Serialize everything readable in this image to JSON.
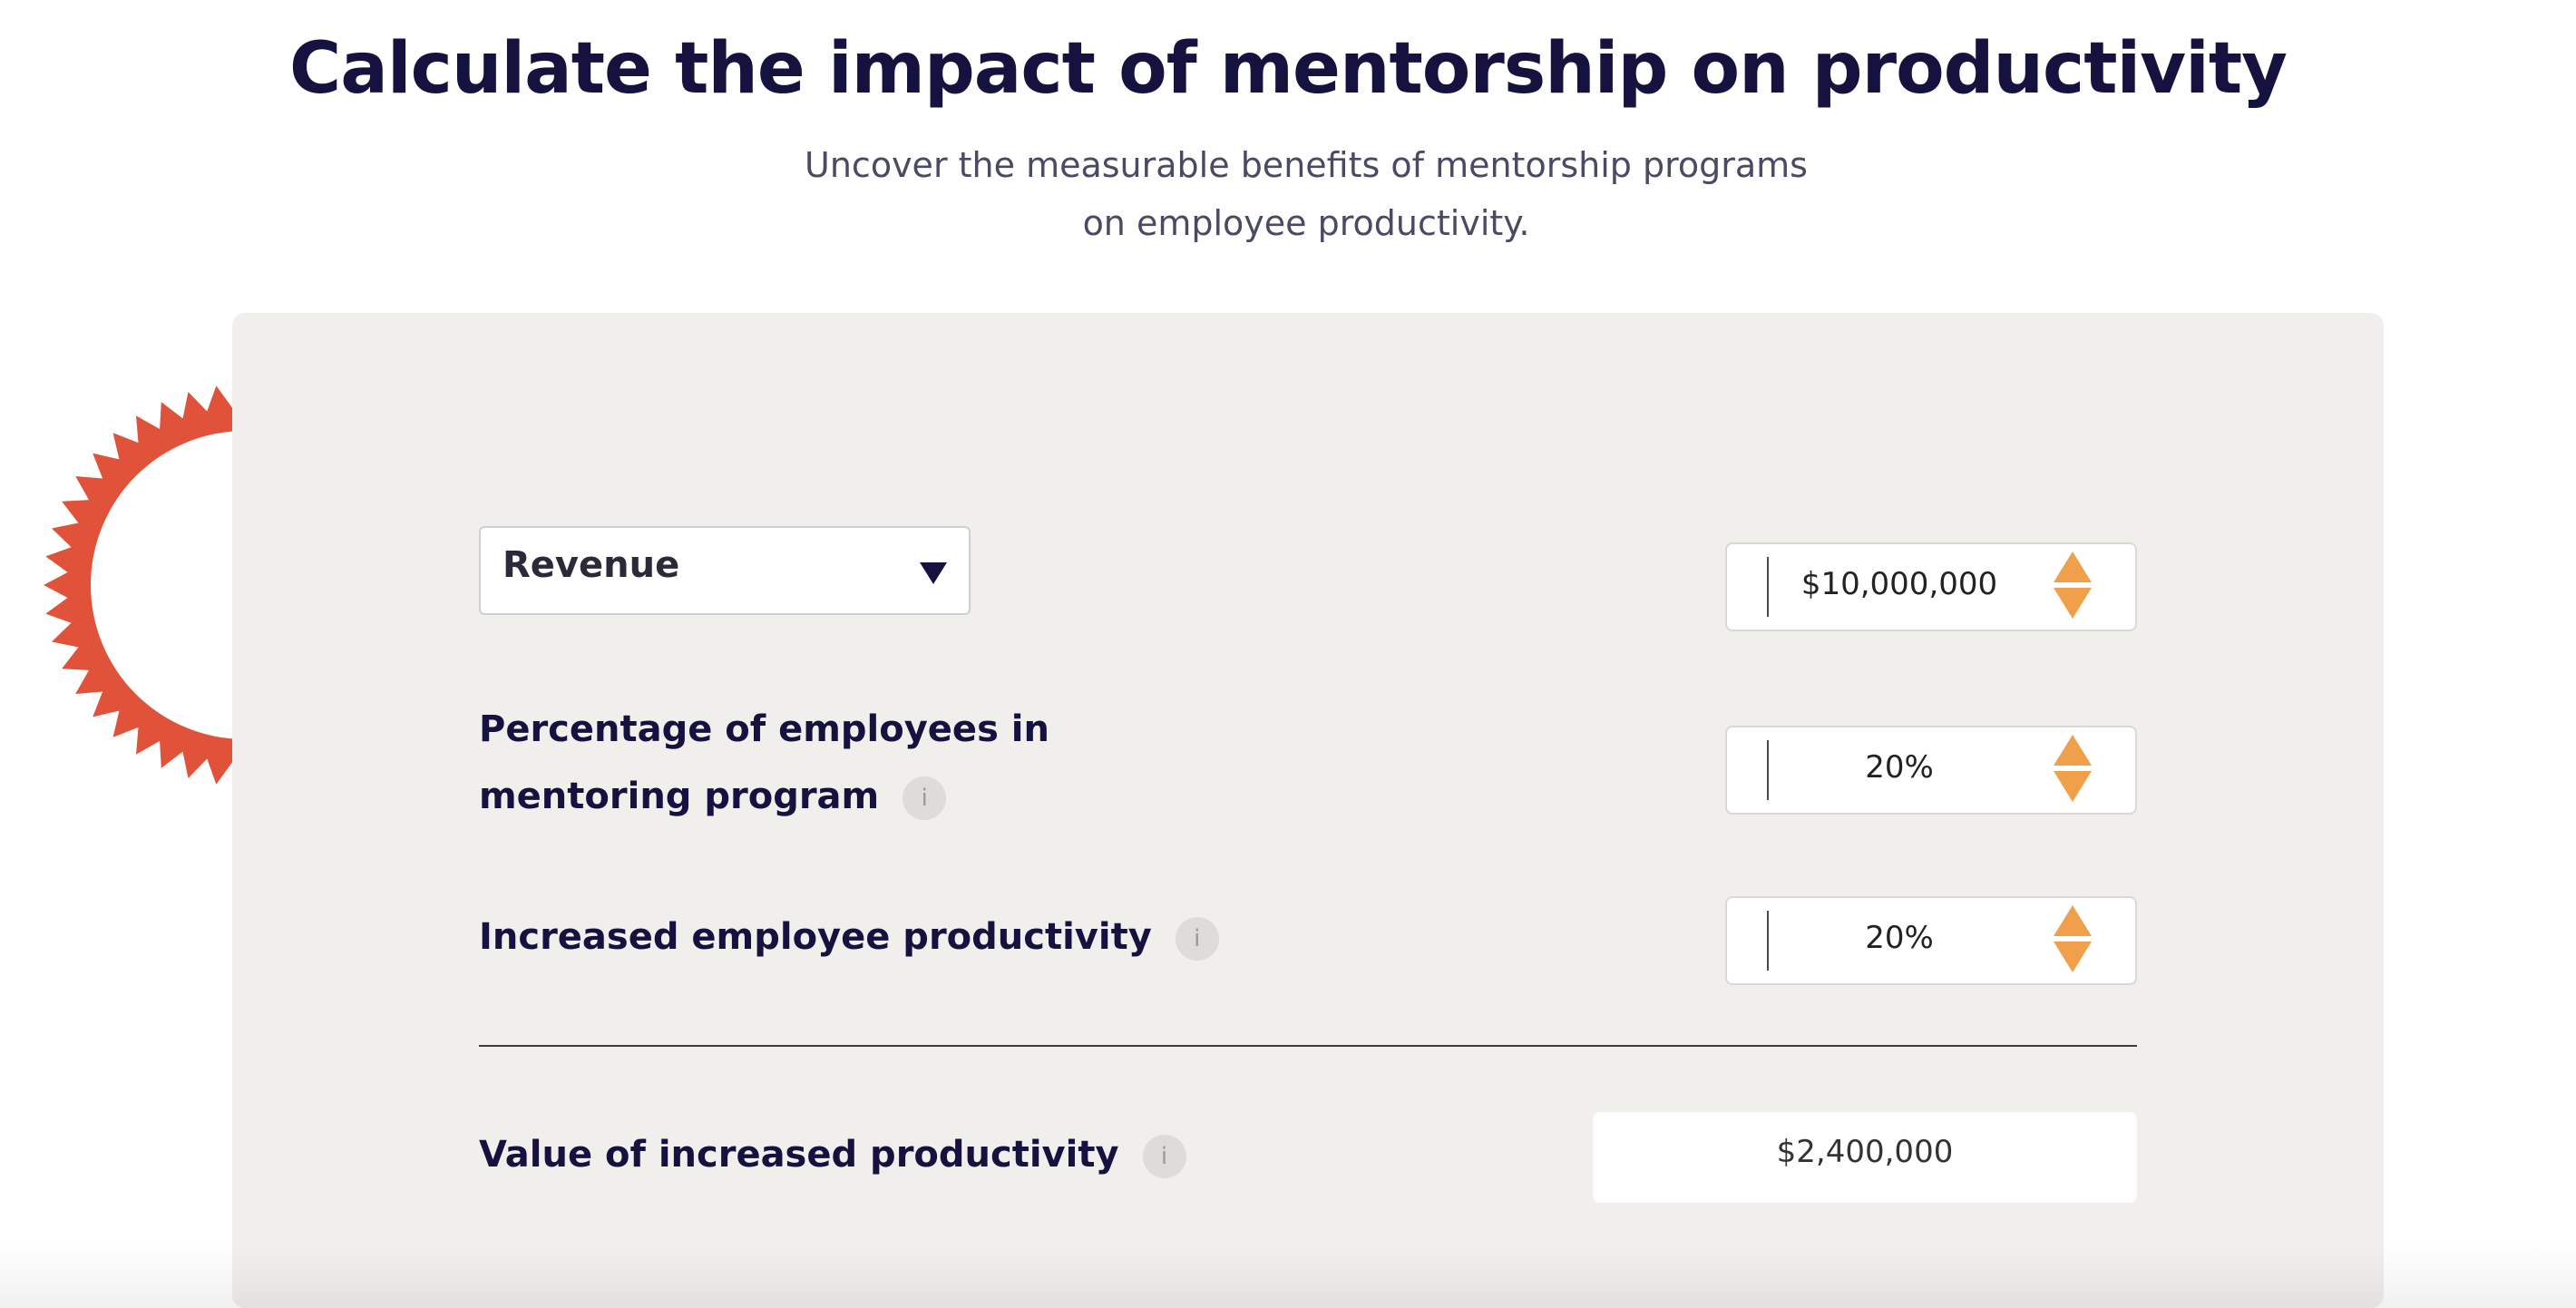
{
  "header": {
    "title": "Calculate the impact of mentorship on productivity",
    "subtitle": "Uncover the measurable benefits of mentorship programs on employee productivity."
  },
  "colors": {
    "title": "#16123f",
    "accent_orange": "#f0a04a",
    "starburst_red": "#e0523a",
    "card_background": "#f0efec"
  },
  "calculator": {
    "metric_select": {
      "selected": "Revenue",
      "icon": "caret-down-icon"
    },
    "revenue_input": {
      "value": "$10,000,000"
    },
    "fields": [
      {
        "label": "Percentage of employees in mentoring program",
        "info_icon": "i",
        "value": "20%"
      },
      {
        "label": "Increased employee productivity",
        "info_icon": "i",
        "value": "20%"
      }
    ],
    "result": {
      "label": "Value of increased productivity",
      "info_icon": "i",
      "value": "$2,400,000"
    }
  }
}
